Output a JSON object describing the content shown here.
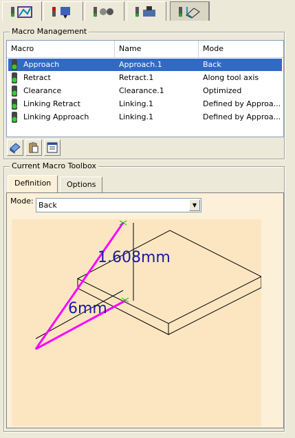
{
  "toolbar_tabs": [
    {
      "icon": "macro-general-icon"
    },
    {
      "icon": "tool-icon"
    },
    {
      "icon": "geometry-icon"
    },
    {
      "icon": "feeds-speeds-icon"
    },
    {
      "icon": "macros-icon",
      "active": true
    }
  ],
  "macro_management": {
    "title": "Macro Management",
    "columns": [
      "Macro",
      "Name",
      "Mode"
    ],
    "rows": [
      {
        "macro": "Approach",
        "name": "Approach.1",
        "mode": "Back",
        "selected": true
      },
      {
        "macro": "Retract",
        "name": "Retract.1",
        "mode": "Along tool axis"
      },
      {
        "macro": "Clearance",
        "name": "Clearance.1",
        "mode": "Optimized"
      },
      {
        "macro": "Linking Retract",
        "name": "Linking.1",
        "mode": "Defined by Approa..."
      },
      {
        "macro": "Linking Approach",
        "name": "Linking.1",
        "mode": "Defined by Approa..."
      }
    ],
    "buttons": [
      "book-icon",
      "paste-icon",
      "properties-icon"
    ]
  },
  "toolbox": {
    "title": "Current Macro Toolbox",
    "tabs": [
      "Definition",
      "Options"
    ],
    "mode_label": "Mode:",
    "mode_value": "Back",
    "dim_height": "1.608mm",
    "dim_length": "6mm"
  },
  "colors": {
    "accent": "#316ac5",
    "magenta": "#ff00ff",
    "dimension_text": "#1a1aa0",
    "panel": "#fdf0d8"
  }
}
